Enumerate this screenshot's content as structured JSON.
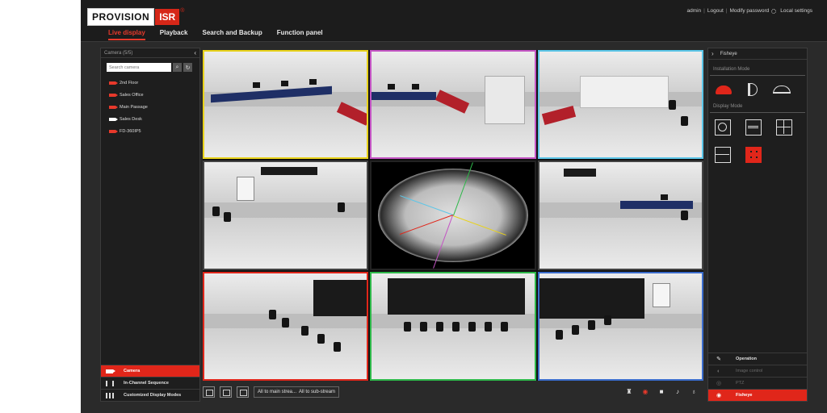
{
  "brand": {
    "name": "PROVISION",
    "suffix": "ISR",
    "registered": "®"
  },
  "user_links": {
    "user": "admin",
    "logout": "Logout",
    "modify_password": "Modify password",
    "local_settings": "Local settings"
  },
  "nav_tabs": [
    {
      "label": "Live display",
      "active": true
    },
    {
      "label": "Playback",
      "active": false
    },
    {
      "label": "Search and Backup",
      "active": false
    },
    {
      "label": "Function panel",
      "active": false
    }
  ],
  "camera_panel": {
    "title": "Camera (5/5)",
    "search_placeholder": "Search camera",
    "cameras": [
      {
        "name": "2nd Floor",
        "icon": "camera-red-icon"
      },
      {
        "name": "Sales Office",
        "icon": "camera-red-icon"
      },
      {
        "name": "Main Passage",
        "icon": "camera-red-icon"
      },
      {
        "name": "Sales Desk",
        "icon": "camera-white-icon"
      },
      {
        "name": "FD-360IP5",
        "icon": "camera-red-icon"
      }
    ],
    "footer": [
      {
        "label": "Camera",
        "active": true
      },
      {
        "label": "In-Channel Sequence",
        "active": false
      },
      {
        "label": "Customized Display Modes",
        "active": false
      }
    ]
  },
  "tile_border_colors": [
    "#e8d21a",
    "#c455c4",
    "#5cc6e8",
    "#444444",
    "#222222",
    "#444444",
    "#e0261a",
    "#2eb84a",
    "#3a6ccc"
  ],
  "bottom_bar": {
    "stream_main": "All to main strea...",
    "stream_sub": "All to sub-stream"
  },
  "fisheye_panel": {
    "title": "Fisheye",
    "installation_mode_label": "Installation Mode",
    "display_mode_label": "Display Mode",
    "footer": [
      {
        "label": "Operation",
        "state": "normal"
      },
      {
        "label": "Image control",
        "state": "dim"
      },
      {
        "label": "PTZ",
        "state": "dim"
      },
      {
        "label": "Fisheye",
        "state": "active"
      }
    ]
  }
}
